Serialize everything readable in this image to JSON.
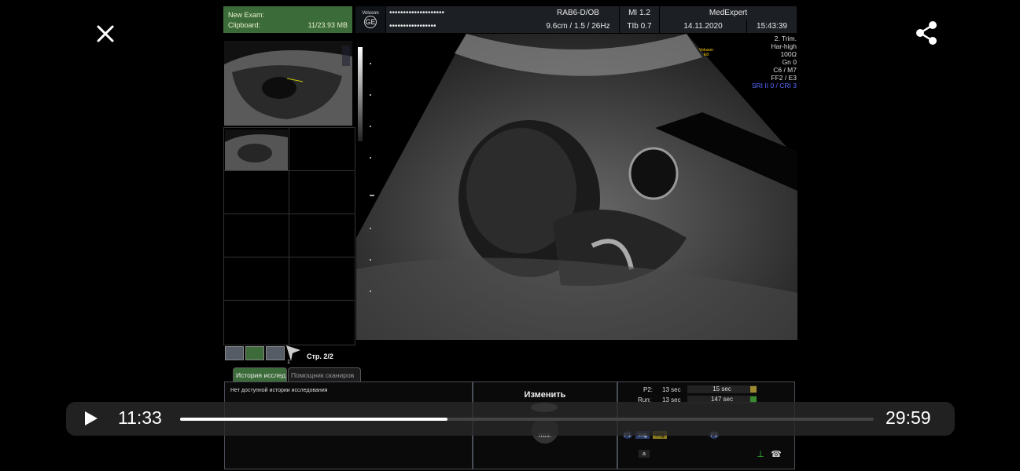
{
  "player": {
    "current_time": "11:33",
    "total_time": "29:59",
    "progress_fraction": 0.385
  },
  "left_panel": {
    "new_exam_label": "New Exam:",
    "clipboard_label": "Clipboard:",
    "clipboard_value": "11/23.93 MB",
    "page_label": "Стр. 2/2",
    "page_marker": "1"
  },
  "header": {
    "brand": "Voluson",
    "brand_sub": "E8",
    "ge": "GE",
    "patient_line1": "••••••••••••••••••••",
    "patient_line2": "•••••••••••••••••",
    "probe": "RAB6-D/OB",
    "depth": "9.6cm / 1.5 / 26Hz",
    "mi": "MI  1.2",
    "tib": "TIb  0.7",
    "institution": "MedExpert",
    "date": "14.11.2020",
    "time": "15:43:39"
  },
  "settings": {
    "brand": "Voluson",
    "brand_sub": "E8",
    "lines": [
      "2. Trim.",
      "Har-high",
      "100Ω",
      "Gn  0",
      "C6 / M7",
      "FF2 / E3"
    ],
    "sri": "SRI II 0 / CRI 3"
  },
  "tabs": {
    "history": "История исслед",
    "assistant": "Помощник сканиров"
  },
  "history_panel": {
    "empty_text": "Нет доступной истории исследования"
  },
  "change_panel": {
    "change_label": "Изменить",
    "pos_label": "поз."
  },
  "run_panel": {
    "p2_label": "P2:",
    "p2_value": "13 sec",
    "p2_bar_value": "15 sec",
    "run_label": "Run:",
    "run_value": "13 sec",
    "run_bar_value": "147 sec",
    "p2_key": "P2",
    "p4_key": "P4",
    "p1_key": "P1",
    "p3_key": "P3",
    "cine1": "Cine",
    "cine2": "Cine",
    "img1": "Img",
    "img2": "Img",
    "a_key": "a"
  },
  "colors": {
    "green_header": "#3c6b3a",
    "player_bg": "#282828",
    "accent_blue": "#5a6cff"
  },
  "icons": {
    "close": "close-icon",
    "share": "share-icon",
    "play": "play-icon"
  }
}
